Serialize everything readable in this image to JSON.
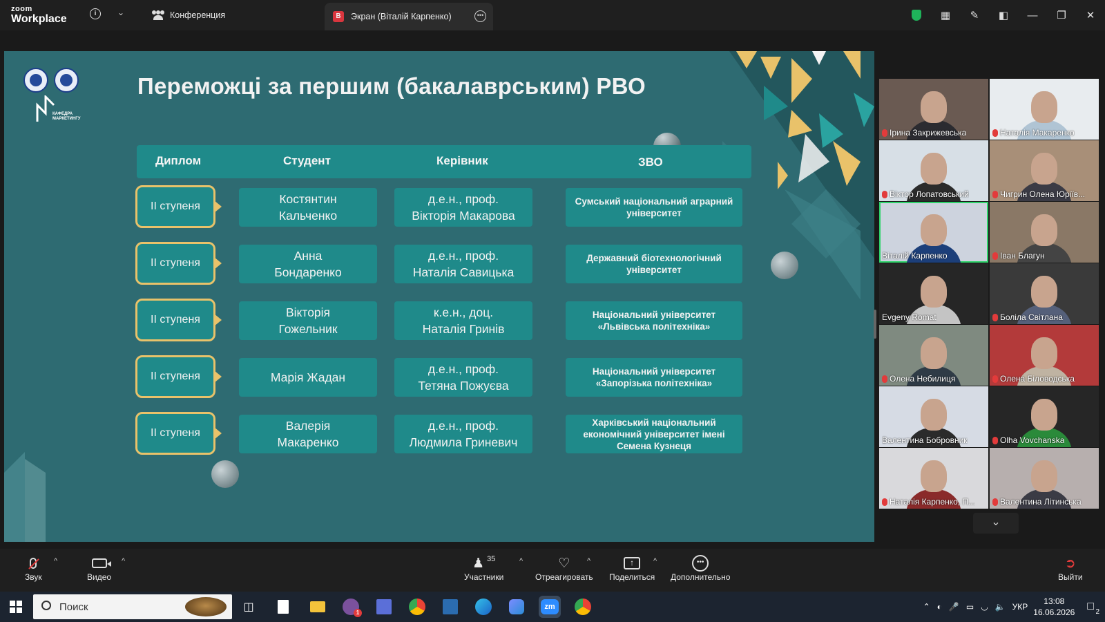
{
  "app": {
    "brand_small": "zoom",
    "brand_big": "Workplace"
  },
  "tabs": {
    "conference": "Конференция",
    "screen_badge": "В",
    "screen": "Экран (Віталій Карпенко)"
  },
  "slide": {
    "title": "Переможці за першим (бакалаврським) РВО",
    "dept_logo_text": "КАФЕДРА МАРКЕТИНГУ",
    "headers": {
      "diploma": "Диплом",
      "student": "Студент",
      "supervisor": "Керівник",
      "university": "ЗВО"
    },
    "rows": [
      {
        "diploma": "ІІ ступеня",
        "student": [
          "Костянтин",
          "Кальченко"
        ],
        "supervisor": [
          "д.е.н., проф.",
          "Вікторія Макарова"
        ],
        "university": [
          "Сумський національний аграрний",
          "університет"
        ]
      },
      {
        "diploma": "ІІ ступеня",
        "student": [
          "Анна",
          "Бондаренко"
        ],
        "supervisor": [
          "д.е.н., проф.",
          "Наталія Савицька"
        ],
        "university": [
          "Державний біотехнологічний",
          "університет"
        ]
      },
      {
        "diploma": "ІІ ступеня",
        "student": [
          "Вікторія",
          "Гожельник"
        ],
        "supervisor": [
          "к.е.н., доц.",
          "Наталія Гринів"
        ],
        "university": [
          "Національний університет",
          "«Львівська політехніка»"
        ]
      },
      {
        "diploma": "ІІ ступеня",
        "student": [
          "Марія Жадан"
        ],
        "supervisor": [
          "д.е.н., проф.",
          "Тетяна Пожуєва"
        ],
        "university": [
          "Національний університет",
          "«Запорізька політехніка»"
        ]
      },
      {
        "diploma": "ІІ ступеня",
        "student": [
          "Валерія",
          "Макаренко"
        ],
        "supervisor": [
          "д.е.н., проф.",
          "Людмила Гриневич"
        ],
        "university": [
          "Харківський національний",
          "економічний університет імені",
          "Семена Кузнеця"
        ]
      }
    ]
  },
  "participants": [
    {
      "name": "Ірина Закрижевська",
      "muted": true
    },
    {
      "name": "Наталія Макаренко",
      "muted": true
    },
    {
      "name": "Віктор Лопатовський",
      "muted": true
    },
    {
      "name": "Чигрин Олена Юріїв...",
      "muted": true
    },
    {
      "name": "Віталій Карпенко",
      "muted": false,
      "active": true
    },
    {
      "name": "Іван Благун",
      "muted": true
    },
    {
      "name": "Evgeny Romat",
      "muted": false
    },
    {
      "name": "Боліла  Світлана",
      "muted": true
    },
    {
      "name": "Олена Небилиця",
      "muted": true
    },
    {
      "name": "Олена Біловодська",
      "muted": true
    },
    {
      "name": "Валентина Бобровник",
      "muted": false
    },
    {
      "name": "Olha Vovchanska",
      "muted": true
    },
    {
      "name": "Наталія Карпенко, П...",
      "muted": true
    },
    {
      "name": "Валентина Літинська",
      "muted": true
    }
  ],
  "toolbar": {
    "audio": "Звук",
    "video": "Видео",
    "participants": "Участники",
    "participants_count": "35",
    "react": "Отреагировать",
    "share": "Поделиться",
    "more": "Дополнительно",
    "leave": "Выйти"
  },
  "taskbar": {
    "search_placeholder": "Поиск",
    "lang": "УКР",
    "time": "13:08",
    "date": "16.06.2026",
    "notifications": "2",
    "viber_badge": "1"
  },
  "colors": {
    "slide_bg": "#2e6b72",
    "cell_bg": "#1f8a8a",
    "accent_gold": "#e9c26a",
    "active_speaker": "#2ed36a"
  }
}
